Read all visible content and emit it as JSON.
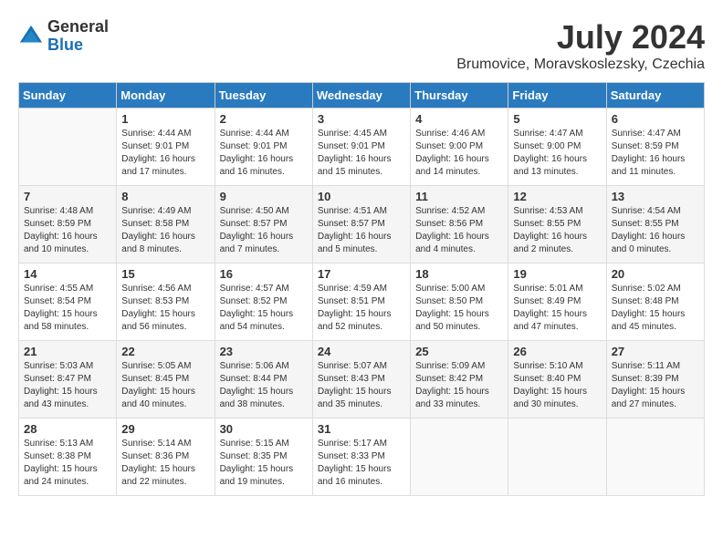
{
  "header": {
    "logo_general": "General",
    "logo_blue": "Blue",
    "month_year": "July 2024",
    "location": "Brumovice, Moravskoslezsky, Czechia"
  },
  "weekdays": [
    "Sunday",
    "Monday",
    "Tuesday",
    "Wednesday",
    "Thursday",
    "Friday",
    "Saturday"
  ],
  "weeks": [
    [
      {
        "day": "",
        "sunrise": "",
        "sunset": "",
        "daylight": ""
      },
      {
        "day": "1",
        "sunrise": "Sunrise: 4:44 AM",
        "sunset": "Sunset: 9:01 PM",
        "daylight": "Daylight: 16 hours and 17 minutes."
      },
      {
        "day": "2",
        "sunrise": "Sunrise: 4:44 AM",
        "sunset": "Sunset: 9:01 PM",
        "daylight": "Daylight: 16 hours and 16 minutes."
      },
      {
        "day": "3",
        "sunrise": "Sunrise: 4:45 AM",
        "sunset": "Sunset: 9:01 PM",
        "daylight": "Daylight: 16 hours and 15 minutes."
      },
      {
        "day": "4",
        "sunrise": "Sunrise: 4:46 AM",
        "sunset": "Sunset: 9:00 PM",
        "daylight": "Daylight: 16 hours and 14 minutes."
      },
      {
        "day": "5",
        "sunrise": "Sunrise: 4:47 AM",
        "sunset": "Sunset: 9:00 PM",
        "daylight": "Daylight: 16 hours and 13 minutes."
      },
      {
        "day": "6",
        "sunrise": "Sunrise: 4:47 AM",
        "sunset": "Sunset: 8:59 PM",
        "daylight": "Daylight: 16 hours and 11 minutes."
      }
    ],
    [
      {
        "day": "7",
        "sunrise": "Sunrise: 4:48 AM",
        "sunset": "Sunset: 8:59 PM",
        "daylight": "Daylight: 16 hours and 10 minutes."
      },
      {
        "day": "8",
        "sunrise": "Sunrise: 4:49 AM",
        "sunset": "Sunset: 8:58 PM",
        "daylight": "Daylight: 16 hours and 8 minutes."
      },
      {
        "day": "9",
        "sunrise": "Sunrise: 4:50 AM",
        "sunset": "Sunset: 8:57 PM",
        "daylight": "Daylight: 16 hours and 7 minutes."
      },
      {
        "day": "10",
        "sunrise": "Sunrise: 4:51 AM",
        "sunset": "Sunset: 8:57 PM",
        "daylight": "Daylight: 16 hours and 5 minutes."
      },
      {
        "day": "11",
        "sunrise": "Sunrise: 4:52 AM",
        "sunset": "Sunset: 8:56 PM",
        "daylight": "Daylight: 16 hours and 4 minutes."
      },
      {
        "day": "12",
        "sunrise": "Sunrise: 4:53 AM",
        "sunset": "Sunset: 8:55 PM",
        "daylight": "Daylight: 16 hours and 2 minutes."
      },
      {
        "day": "13",
        "sunrise": "Sunrise: 4:54 AM",
        "sunset": "Sunset: 8:55 PM",
        "daylight": "Daylight: 16 hours and 0 minutes."
      }
    ],
    [
      {
        "day": "14",
        "sunrise": "Sunrise: 4:55 AM",
        "sunset": "Sunset: 8:54 PM",
        "daylight": "Daylight: 15 hours and 58 minutes."
      },
      {
        "day": "15",
        "sunrise": "Sunrise: 4:56 AM",
        "sunset": "Sunset: 8:53 PM",
        "daylight": "Daylight: 15 hours and 56 minutes."
      },
      {
        "day": "16",
        "sunrise": "Sunrise: 4:57 AM",
        "sunset": "Sunset: 8:52 PM",
        "daylight": "Daylight: 15 hours and 54 minutes."
      },
      {
        "day": "17",
        "sunrise": "Sunrise: 4:59 AM",
        "sunset": "Sunset: 8:51 PM",
        "daylight": "Daylight: 15 hours and 52 minutes."
      },
      {
        "day": "18",
        "sunrise": "Sunrise: 5:00 AM",
        "sunset": "Sunset: 8:50 PM",
        "daylight": "Daylight: 15 hours and 50 minutes."
      },
      {
        "day": "19",
        "sunrise": "Sunrise: 5:01 AM",
        "sunset": "Sunset: 8:49 PM",
        "daylight": "Daylight: 15 hours and 47 minutes."
      },
      {
        "day": "20",
        "sunrise": "Sunrise: 5:02 AM",
        "sunset": "Sunset: 8:48 PM",
        "daylight": "Daylight: 15 hours and 45 minutes."
      }
    ],
    [
      {
        "day": "21",
        "sunrise": "Sunrise: 5:03 AM",
        "sunset": "Sunset: 8:47 PM",
        "daylight": "Daylight: 15 hours and 43 minutes."
      },
      {
        "day": "22",
        "sunrise": "Sunrise: 5:05 AM",
        "sunset": "Sunset: 8:45 PM",
        "daylight": "Daylight: 15 hours and 40 minutes."
      },
      {
        "day": "23",
        "sunrise": "Sunrise: 5:06 AM",
        "sunset": "Sunset: 8:44 PM",
        "daylight": "Daylight: 15 hours and 38 minutes."
      },
      {
        "day": "24",
        "sunrise": "Sunrise: 5:07 AM",
        "sunset": "Sunset: 8:43 PM",
        "daylight": "Daylight: 15 hours and 35 minutes."
      },
      {
        "day": "25",
        "sunrise": "Sunrise: 5:09 AM",
        "sunset": "Sunset: 8:42 PM",
        "daylight": "Daylight: 15 hours and 33 minutes."
      },
      {
        "day": "26",
        "sunrise": "Sunrise: 5:10 AM",
        "sunset": "Sunset: 8:40 PM",
        "daylight": "Daylight: 15 hours and 30 minutes."
      },
      {
        "day": "27",
        "sunrise": "Sunrise: 5:11 AM",
        "sunset": "Sunset: 8:39 PM",
        "daylight": "Daylight: 15 hours and 27 minutes."
      }
    ],
    [
      {
        "day": "28",
        "sunrise": "Sunrise: 5:13 AM",
        "sunset": "Sunset: 8:38 PM",
        "daylight": "Daylight: 15 hours and 24 minutes."
      },
      {
        "day": "29",
        "sunrise": "Sunrise: 5:14 AM",
        "sunset": "Sunset: 8:36 PM",
        "daylight": "Daylight: 15 hours and 22 minutes."
      },
      {
        "day": "30",
        "sunrise": "Sunrise: 5:15 AM",
        "sunset": "Sunset: 8:35 PM",
        "daylight": "Daylight: 15 hours and 19 minutes."
      },
      {
        "day": "31",
        "sunrise": "Sunrise: 5:17 AM",
        "sunset": "Sunset: 8:33 PM",
        "daylight": "Daylight: 15 hours and 16 minutes."
      },
      {
        "day": "",
        "sunrise": "",
        "sunset": "",
        "daylight": ""
      },
      {
        "day": "",
        "sunrise": "",
        "sunset": "",
        "daylight": ""
      },
      {
        "day": "",
        "sunrise": "",
        "sunset": "",
        "daylight": ""
      }
    ]
  ]
}
